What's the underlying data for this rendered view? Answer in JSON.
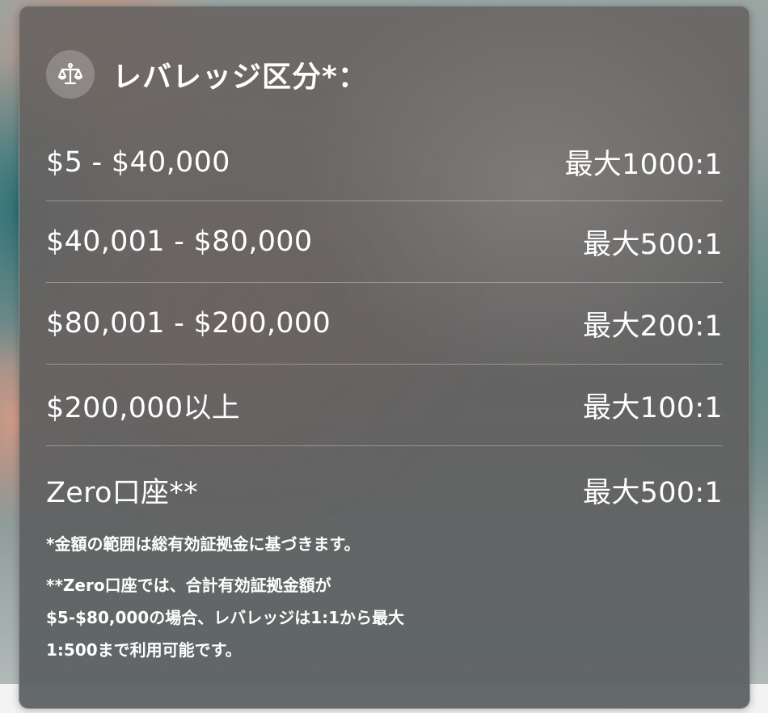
{
  "leverage_panel": {
    "title": "レバレッジ区分*：",
    "icon": "scale-icon",
    "rows": [
      {
        "range": "$5 - $40,000",
        "leverage": "最大1000:1"
      },
      {
        "range": "$40,001 - $80,000",
        "leverage": "最大500:1"
      },
      {
        "range": "$80,001 - $200,000",
        "leverage": "最大200:1"
      },
      {
        "range": "$200,000以上",
        "leverage": "最大100:1"
      },
      {
        "range": "Zero口座**",
        "leverage": "最大500:1"
      }
    ],
    "note1": "*金額の範囲は総有効証拠金に基づきます。",
    "note2_lines": [
      "**Zero口座では、合計有効証拠金額が",
      "$5-$80,000の場合、レバレッジは1:1から最大",
      "1:500まで利用可能です。"
    ]
  }
}
